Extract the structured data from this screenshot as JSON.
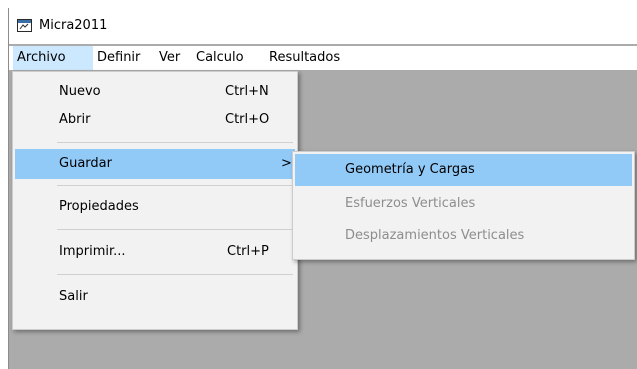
{
  "window": {
    "title": "Micra2011"
  },
  "menubar": [
    {
      "label": "Archivo"
    },
    {
      "label": "Definir"
    },
    {
      "label": "Ver"
    },
    {
      "label": "Calculo"
    },
    {
      "label": "Resultados"
    }
  ],
  "archivo_menu": {
    "nuevo": {
      "label": "Nuevo",
      "shortcut": "Ctrl+N"
    },
    "abrir": {
      "label": "Abrir",
      "shortcut": "Ctrl+O"
    },
    "guardar": {
      "label": "Guardar",
      "submenu_glyph": ">"
    },
    "propiedades": {
      "label": "Propiedades"
    },
    "imprimir": {
      "label": "Imprimir...",
      "shortcut": "Ctrl+P"
    },
    "salir": {
      "label": "Salir"
    }
  },
  "guardar_submenu": [
    {
      "label": "Geometría y Cargas",
      "enabled": true
    },
    {
      "label": "Esfuerzos Verticales",
      "enabled": false
    },
    {
      "label": "Desplazamientos Verticales",
      "enabled": false
    }
  ],
  "colors": {
    "menu_highlight": "#91c9f7",
    "active_menu": "#cce8ff",
    "workspace": "#ababab",
    "disabled_text": "#8d8d8d"
  }
}
